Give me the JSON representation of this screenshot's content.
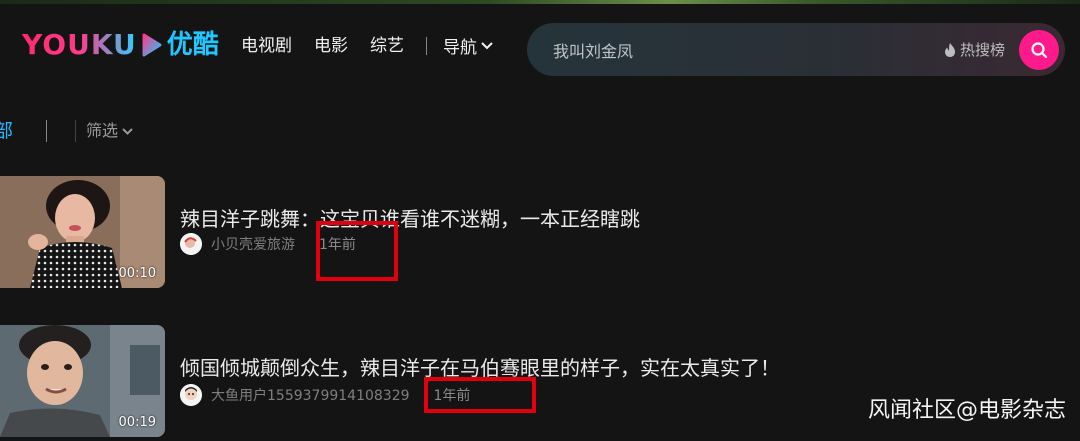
{
  "header": {
    "logo_text": "YOUKU",
    "logo_cn": "优酷",
    "nav": [
      "电视剧",
      "电影",
      "综艺"
    ],
    "nav_guide": "导航",
    "search": {
      "value": "我叫刘金凤",
      "hot_label": "热搜榜"
    }
  },
  "filter_bar": {
    "active_tab_partial": "部",
    "filter_label": "筛选"
  },
  "videos": [
    {
      "title": "辣目洋子跳舞：这宝贝谁看谁不迷糊，一本正经瞎跳",
      "uploader": "小贝壳爱旅游",
      "time": "1年前",
      "duration": "00:10"
    },
    {
      "title": "倾国倾城颠倒众生，辣目洋子在马伯骞眼里的样子，实在太真实了！",
      "uploader": "大鱼用户1559379914108329",
      "time": "1年前",
      "duration": "00:19"
    }
  ],
  "watermark": "风闻社区@电影杂志",
  "colors": {
    "background": "#141414",
    "accent_pink": "#ff1a8c",
    "accent_blue": "#22c7ff",
    "highlight_box": "#e00010"
  }
}
